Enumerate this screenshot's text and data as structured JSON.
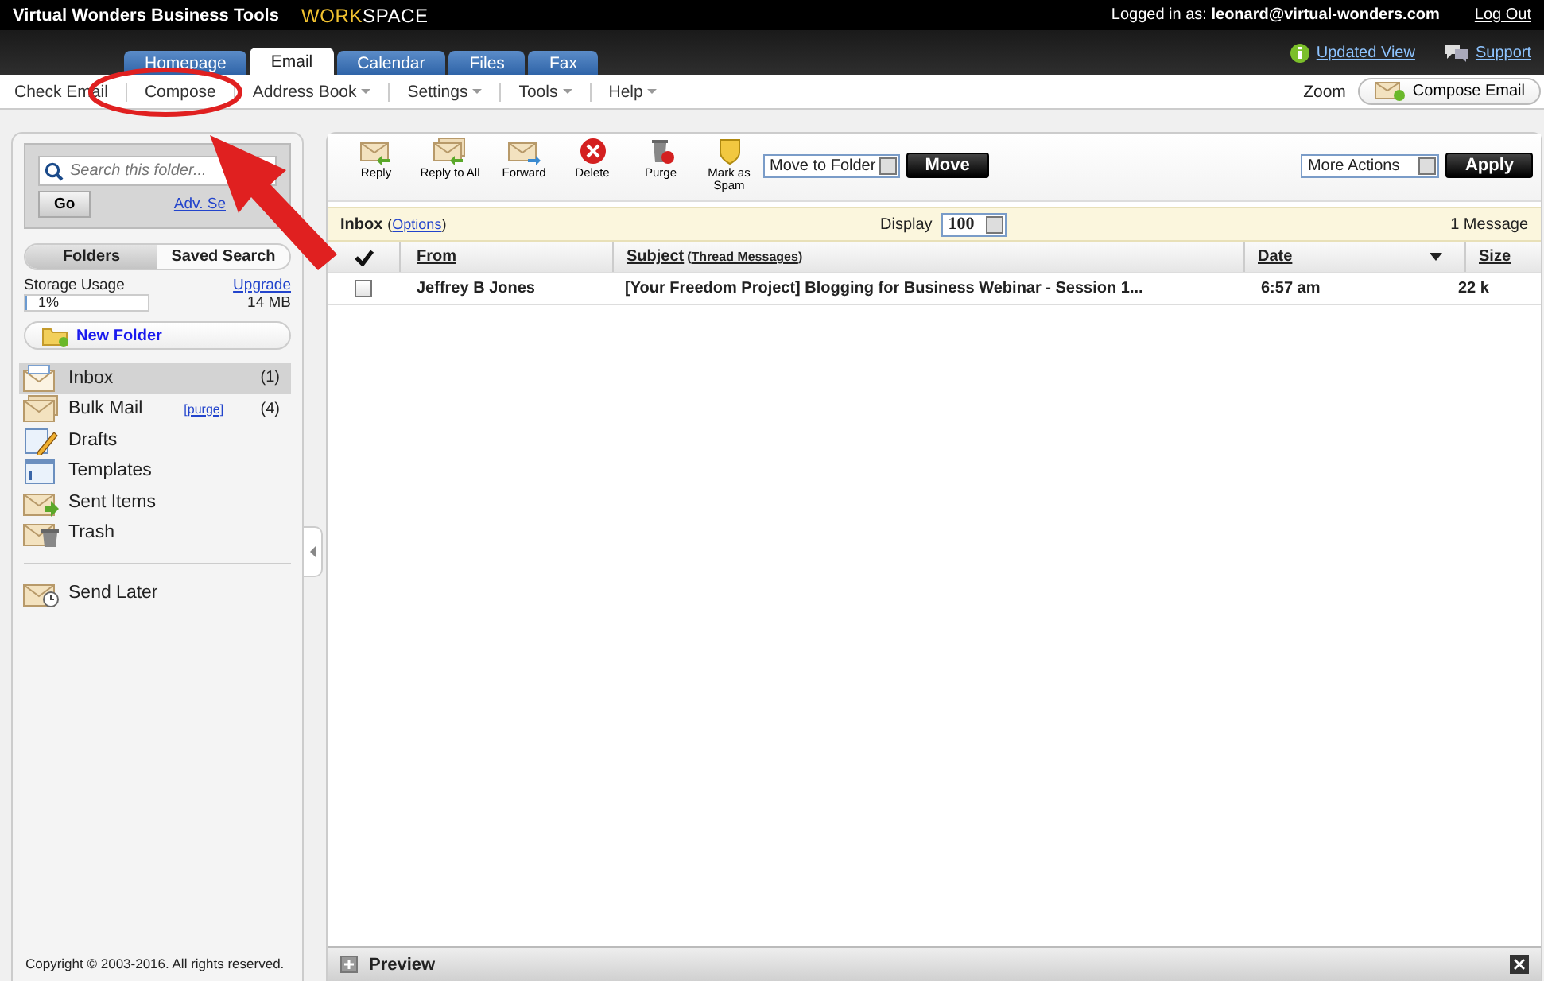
{
  "header": {
    "brand": "Virtual Wonders Business Tools",
    "logo_parts": [
      "WORK",
      "SPACE"
    ],
    "login_label": "Logged in as:",
    "login_user": "leonard@virtual-wonders.com",
    "logout": "Log Out"
  },
  "tabs": [
    {
      "label": "Homepage",
      "selected": false
    },
    {
      "label": "Email",
      "selected": true
    },
    {
      "label": "Calendar",
      "selected": false
    },
    {
      "label": "Files",
      "selected": false
    },
    {
      "label": "Fax",
      "selected": false
    }
  ],
  "top_links": [
    {
      "kind": "updated",
      "label": "Updated View"
    },
    {
      "kind": "support",
      "label": "Support"
    }
  ],
  "menu": [
    {
      "label": "Check Email",
      "dropdown": false
    },
    {
      "label": "Compose",
      "dropdown": false
    },
    {
      "label": "Address Book",
      "dropdown": true
    },
    {
      "label": "Settings",
      "dropdown": true
    },
    {
      "label": "Tools",
      "dropdown": true
    },
    {
      "label": "Help",
      "dropdown": true
    }
  ],
  "zoom_label": "Zoom",
  "compose_button": "Compose Email",
  "sidebar": {
    "search_placeholder": "Search this folder...",
    "go": "Go",
    "adv_search": "Adv. Se",
    "views": [
      {
        "label": "Folders",
        "selected": true
      },
      {
        "label": "Saved Search",
        "selected": false
      }
    ],
    "storage": {
      "label": "Storage Usage",
      "upgrade": "Upgrade",
      "level": 0.01,
      "percent": "1%",
      "size": "14 MB"
    },
    "new_folder": "New Folder",
    "folders": [
      {
        "kind": "inbox",
        "name": "Inbox",
        "count": "(1)",
        "selected": true
      },
      {
        "kind": "bulk",
        "name": "Bulk Mail",
        "purge": "[purge]",
        "count": "(4)",
        "selected": false
      },
      {
        "kind": "drafts",
        "name": "Drafts",
        "selected": false
      },
      {
        "kind": "templates",
        "name": "Templates",
        "selected": false
      },
      {
        "kind": "sent",
        "name": "Sent Items",
        "selected": false
      },
      {
        "kind": "trash",
        "name": "Trash",
        "selected": false
      }
    ],
    "other_folders": [
      {
        "kind": "later",
        "name": "Send Later",
        "selected": false
      }
    ],
    "copyright": "Copyright © 2003-2016. All rights reserved."
  },
  "toolbar": {
    "actions": [
      {
        "kind": "reply",
        "label": "Reply"
      },
      {
        "kind": "reply_all",
        "label": "Reply to All"
      },
      {
        "kind": "forward",
        "label": "Forward"
      },
      {
        "kind": "delete",
        "label": "Delete"
      },
      {
        "kind": "purge",
        "label": "Purge"
      },
      {
        "kind": "spam",
        "label": "Mark as Spam"
      }
    ],
    "move_select": "Move to Folder",
    "move_button": "Move",
    "actions_select": "More Actions",
    "apply_button": "Apply"
  },
  "info_bar": {
    "folder": "Inbox",
    "options_open": "(",
    "options": "Options",
    "options_close": ")",
    "display_label": "Display",
    "display_value": "100",
    "count": "1 Message"
  },
  "table": {
    "columns": [
      {
        "label": "From"
      },
      {
        "label": "Subject",
        "extra_open": "(",
        "extra": "Thread Messages",
        "extra_close": ")"
      },
      {
        "label": "Date",
        "sorted": true
      },
      {
        "label": "Size"
      }
    ],
    "rows": [
      {
        "checked": false,
        "unread": true,
        "from": "Jeffrey B Jones",
        "subject": "[Your Freedom Project] Blogging for Business Webinar - Session 1...",
        "date": "6:57 am",
        "size": "22 k"
      }
    ]
  },
  "preview": {
    "label": "Preview"
  }
}
